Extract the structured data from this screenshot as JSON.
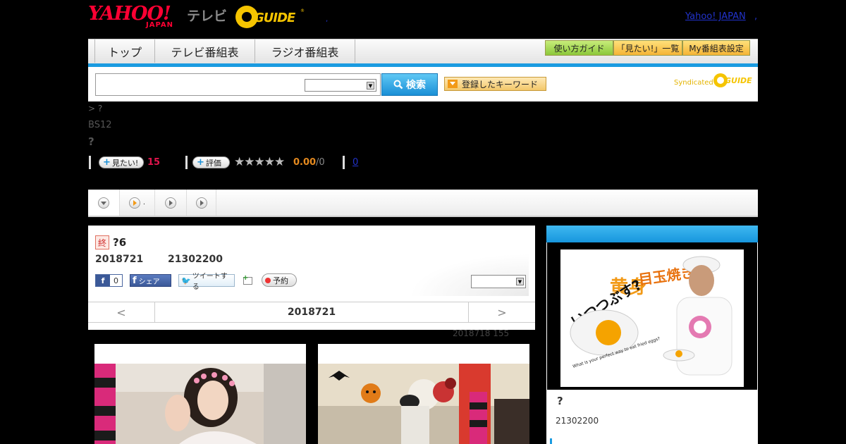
{
  "header": {
    "yahoo_logo": "YAHOO!",
    "yahoo_sub": "JAPAN",
    "tv_label": "テレビ",
    "gguide_text": "GUIDE",
    "gguide_reg": "®",
    "yahoo_link": "Yahoo! JAPAN",
    "dot": ","
  },
  "nav": {
    "tabs": [
      {
        "label": "トップ"
      },
      {
        "label": "テレビ番組表"
      },
      {
        "label": "ラジオ番組表"
      }
    ],
    "right_buttons": [
      {
        "label": "使い方ガイド"
      },
      {
        "label": "「見たい!」一覧"
      },
      {
        "label": "My番組表設定"
      }
    ]
  },
  "search": {
    "input_value": "",
    "select_value": "",
    "button_label": "検索",
    "keyword_button": "登録したキーワード",
    "syndicated_text": "Syndicated",
    "syndicated_logo": "GUIDE"
  },
  "program": {
    "breadcrumb": "> ?",
    "channel": "BS12",
    "title": "?",
    "want_label": "見たい!",
    "want_count": "15",
    "rate_label": "評価",
    "stars": "★★★★★",
    "rating": "0.00",
    "rating_max": "/0",
    "comment_count": "0"
  },
  "tabs": {
    "items": [
      {
        "icon": "down-circle-icon",
        "label": ""
      },
      {
        "icon": "play-circle-icon",
        "label": "."
      },
      {
        "icon": "play-circle-icon",
        "label": ""
      },
      {
        "icon": "play-circle-icon",
        "label": ""
      }
    ]
  },
  "episode": {
    "end_badge": "終",
    "title": "?6",
    "date": "2018721",
    "time": "21302200",
    "fb_like_count": "0",
    "fb_share": "シェア",
    "tweet": "ツイートする",
    "reserve": "予約",
    "select_value": ""
  },
  "datenav": {
    "prev": "<",
    "date": "2018721",
    "next": ">"
  },
  "updated": "2018718  155",
  "side": {
    "poster_title": "目玉焼きの黄身 いつつぶす?",
    "poster_sub": "What is your perfect way to eat fried eggs?",
    "program_name": "?",
    "time": "21302200"
  },
  "colors": {
    "accent_blue": "#1a9be0",
    "yahoo_red": "#ff0033",
    "gguide_yellow": "#f5c400",
    "want_red": "#e0144c",
    "rating_orange": "#e58a1f"
  }
}
